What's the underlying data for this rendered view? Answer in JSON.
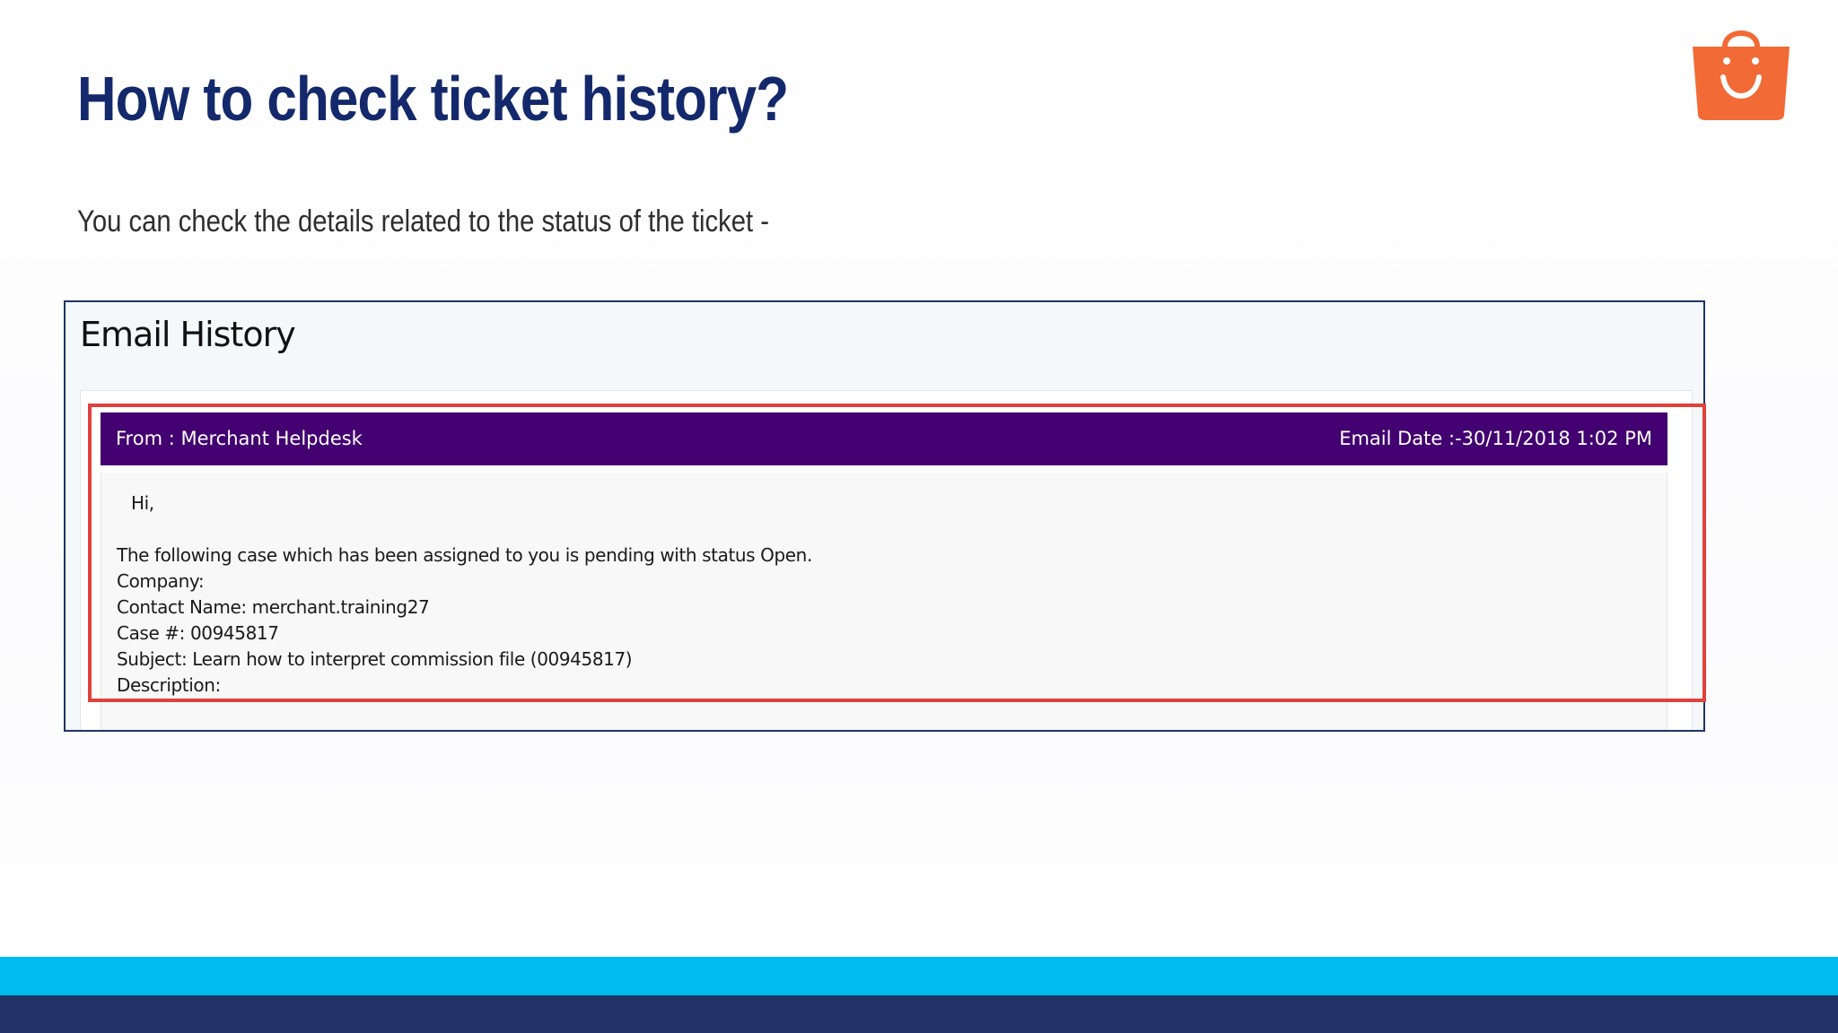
{
  "slide": {
    "title": "How to check ticket history?",
    "subtitle": "You can check the details related to the status of the ticket -",
    "logo_icon": "shopping-bag-smile-icon"
  },
  "email_history": {
    "heading": "Email History",
    "email": {
      "from": "From : Merchant Helpdesk",
      "date": "Email Date :-30/11/2018 1:02 PM",
      "greeting": "Hi,",
      "body_lines": [
        "The following case which has been assigned to you is pending with status Open.",
        "Company:",
        "Contact Name:  merchant.training27",
        "Case #:  00945817",
        "Subject:  Learn how to interpret commission file (00945817)",
        "Description:"
      ]
    }
  },
  "colors": {
    "title": "#14296b",
    "email_header_bg": "#420070",
    "highlight_border": "#e0413c",
    "logo": "#f26a36",
    "footer_cyan": "#00bbee",
    "footer_navy": "#213266"
  }
}
